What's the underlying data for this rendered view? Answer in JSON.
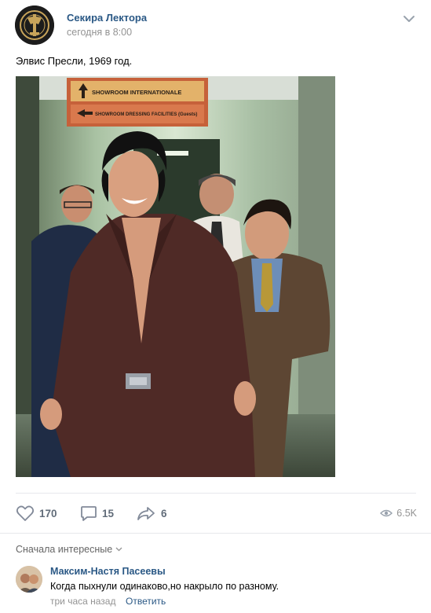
{
  "post": {
    "author": "Секира Лектора",
    "time": "сегодня в 8:00",
    "text": "Элвис Пресли, 1969 год.",
    "photo_sign": {
      "line1": "SHOWROOM INTERNATIONALE",
      "line2": "SHOWROOM DRESSING FACILITIES (Guests)"
    }
  },
  "actions": {
    "likes": "170",
    "comments": "15",
    "shares": "6",
    "views": "6.5K"
  },
  "comments_section": {
    "sort_label": "Сначала интересные",
    "items": [
      {
        "author": "Максим-Настя Пасеевы",
        "text": "Когда пыхнули одинаково,но накрыло по разному.",
        "time": "три часа назад",
        "reply_label": "Ответить"
      }
    ]
  },
  "colors": {
    "link": "#2a5885",
    "muted": "#939393",
    "icon": "#828282"
  },
  "icons": [
    "avatar-emblem",
    "chevron-down-icon",
    "heart-icon",
    "comment-icon",
    "share-icon",
    "eye-icon",
    "sort-chevron-icon"
  ]
}
